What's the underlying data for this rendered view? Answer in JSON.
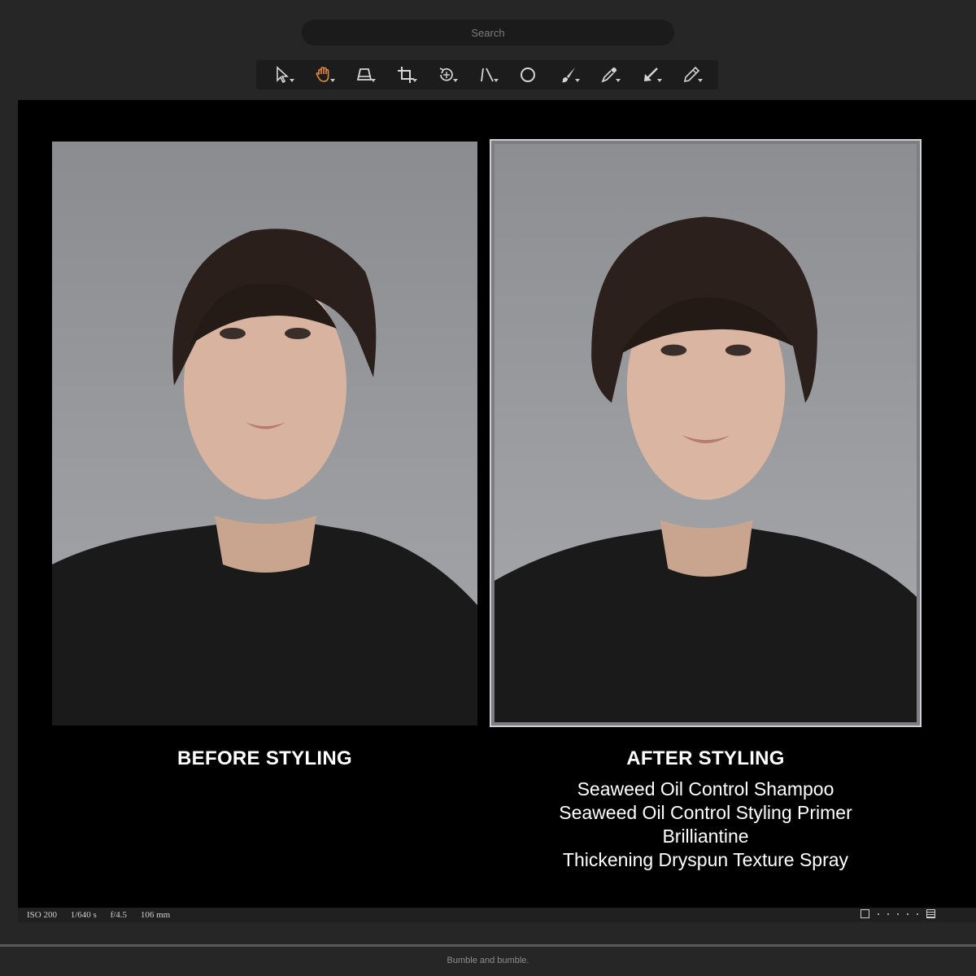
{
  "search": {
    "placeholder": "Search"
  },
  "toolbar": {
    "tools": [
      {
        "icon": "pointer-icon"
      },
      {
        "icon": "hand-pan-icon",
        "active": true
      },
      {
        "icon": "keystone-icon"
      },
      {
        "icon": "crop-icon"
      },
      {
        "icon": "rotate-icon"
      },
      {
        "icon": "straighten-icon"
      },
      {
        "icon": "circle-select-icon"
      },
      {
        "icon": "brush-icon"
      },
      {
        "icon": "eyedropper-icon"
      },
      {
        "icon": "arrow-pick-icon"
      },
      {
        "icon": "pencil-icon"
      }
    ],
    "active_color": "#e68a2e"
  },
  "viewer": {
    "before": {
      "title": "BEFORE STYLING"
    },
    "after": {
      "title": "AFTER STYLING",
      "products": [
        "Seaweed Oil Control Shampoo",
        "Seaweed Oil Control Styling Primer",
        "Brilliantine",
        "Thickening Dryspun Texture Spray"
      ]
    }
  },
  "statusbar": {
    "iso": "ISO 200",
    "shutter": "1/640 s",
    "aperture": "f/4.5",
    "focal": "106 mm"
  },
  "footer": {
    "caption": "Bumble and bumble."
  }
}
